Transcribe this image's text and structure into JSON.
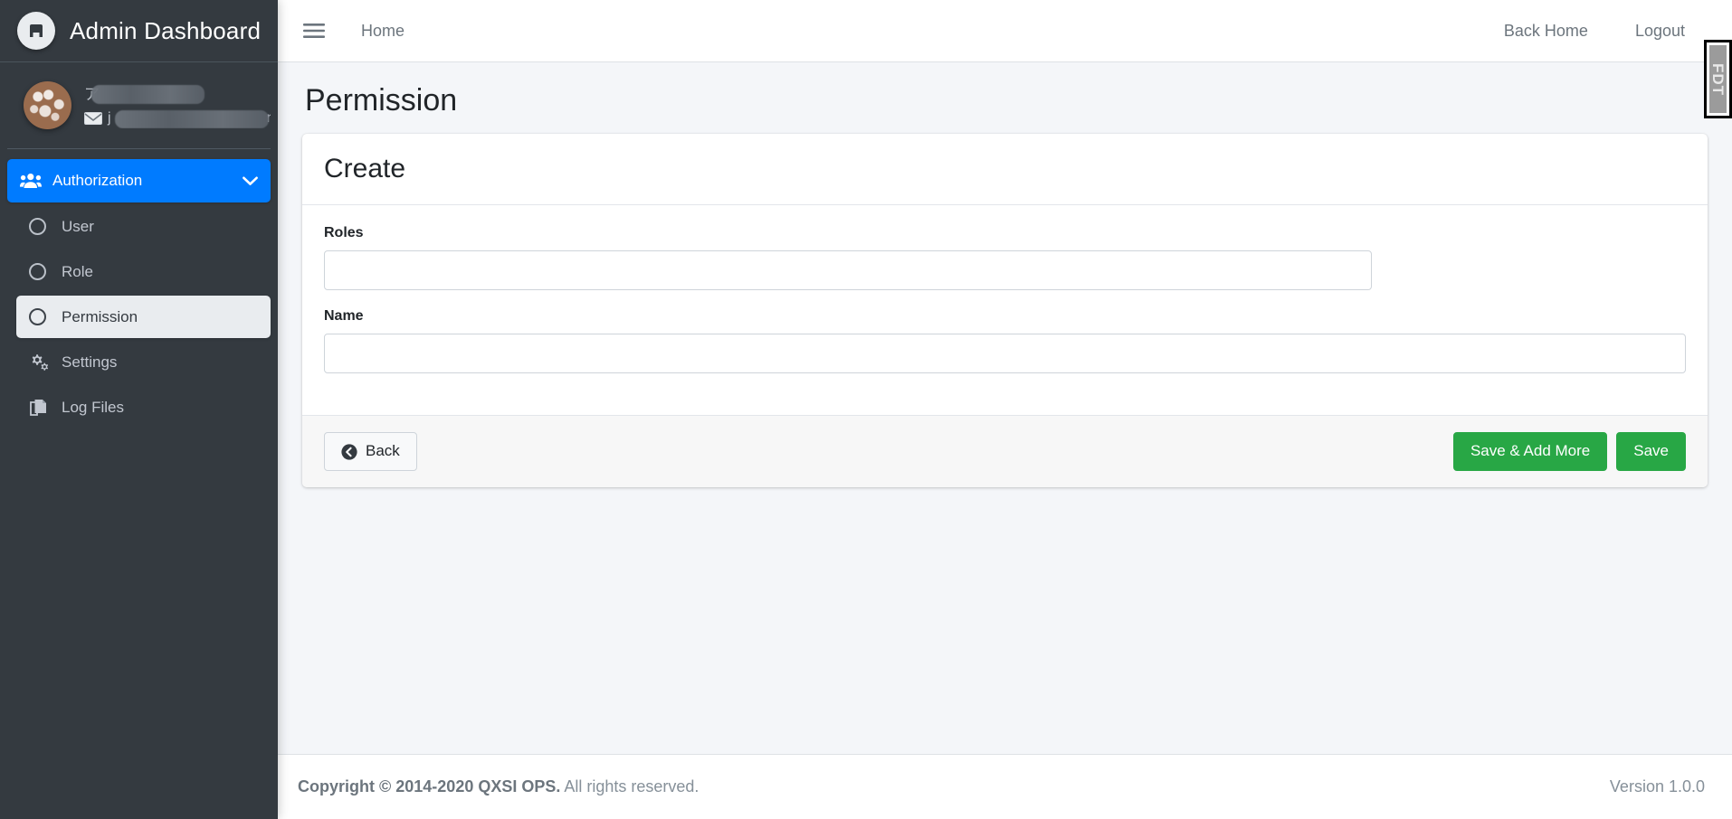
{
  "brand": {
    "title": "Admin Dashboard",
    "logo_icon": "letter-a-circle-icon"
  },
  "user_panel": {
    "name": "ア",
    "name_redacted": true,
    "email_prefix": "j",
    "email_suffix": "m",
    "email_redacted": true,
    "avatar_icon": "user-avatar"
  },
  "sidebar": {
    "items": [
      {
        "label": "Authorization",
        "icon": "users-icon",
        "state": "active-parent",
        "chevron": "chevron-down-icon"
      },
      {
        "label": "User",
        "icon": "circle-outline-icon",
        "state": "child"
      },
      {
        "label": "Role",
        "icon": "circle-outline-icon",
        "state": "child"
      },
      {
        "label": "Permission",
        "icon": "circle-outline-icon",
        "state": "active-child"
      },
      {
        "label": "Settings",
        "icon": "gears-icon",
        "state": "normal"
      },
      {
        "label": "Log Files",
        "icon": "copy-files-icon",
        "state": "normal"
      }
    ]
  },
  "navbar": {
    "menu_icon": "hamburger-icon",
    "home_label": "Home",
    "back_home_label": "Back Home",
    "logout_label": "Logout"
  },
  "floating_tab": {
    "label": "FDT"
  },
  "page": {
    "title": "Permission"
  },
  "card": {
    "title": "Create",
    "fields": [
      {
        "label": "Roles",
        "value": "",
        "placeholder": ""
      },
      {
        "label": "Name",
        "value": "",
        "placeholder": ""
      }
    ],
    "footer": {
      "back_label": "Back",
      "back_icon": "arrow-circle-left-icon",
      "save_add_more_label": "Save & Add More",
      "save_label": "Save"
    }
  },
  "footer": {
    "copyright_bold": "Copyright © 2014-2020 QXSI OPS.",
    "copyright_rest": " All rights reserved.",
    "version": "Version 1.0.0"
  },
  "colors": {
    "accent_blue": "#007bff",
    "success_green": "#28a745",
    "sidebar_dark": "#343a40",
    "page_bg": "#f4f6f9"
  }
}
